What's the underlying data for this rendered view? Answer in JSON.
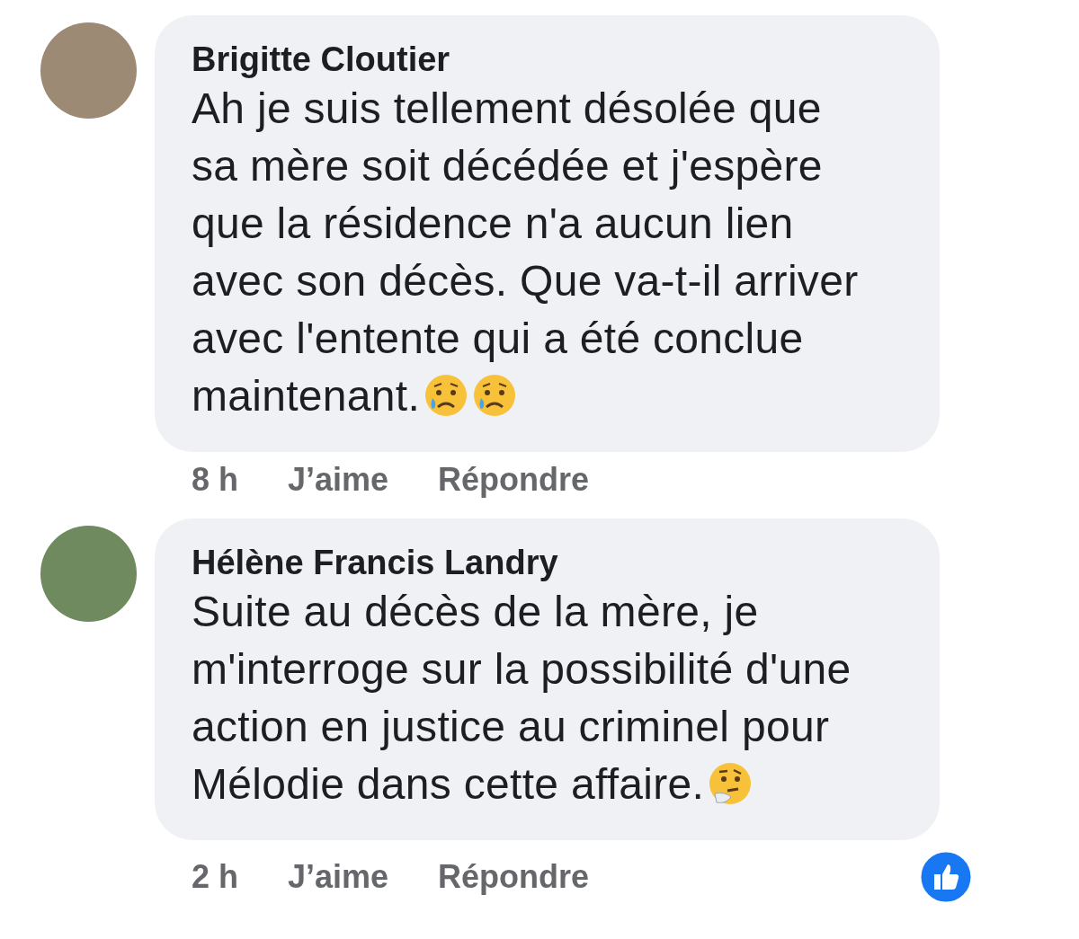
{
  "comments": [
    {
      "author": "Brigitte Cloutier",
      "text": "Ah je suis tellement désolée que sa mère soit décédée et j'espère que la résidence n'a aucun lien avec son décès. Que va-t-il arriver avec l'entente qui a été conclue maintenant.",
      "emojis": [
        {
          "kind": "sad-tear"
        },
        {
          "kind": "sad-tear"
        }
      ],
      "time": "8 h",
      "actions": [
        "J’aime",
        "Répondre"
      ]
    },
    {
      "author": "Hélène Francis Landry",
      "text": "Suite au décès de la mère, je m'interroge sur la possibilité d'une action en justice au criminel pour Mélodie dans cette affaire.",
      "emojis": [
        {
          "kind": "thinking"
        }
      ],
      "time": "2 h",
      "actions": [
        "J’aime",
        "Répondre"
      ],
      "reactions": [
        {
          "kind": "like"
        }
      ]
    }
  ]
}
